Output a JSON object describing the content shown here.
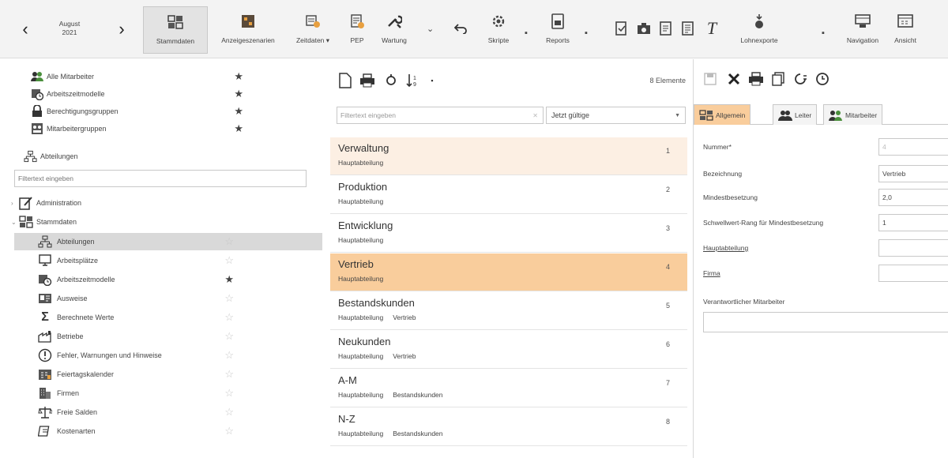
{
  "toolbar": {
    "date_month": "August",
    "date_year": "2021",
    "items": [
      {
        "label": "Stammdaten",
        "active": true
      },
      {
        "label": "Anzeigeszenarien"
      },
      {
        "label": "Zeitdaten ▾"
      },
      {
        "label": "PEP"
      },
      {
        "label": "Wartung"
      },
      {
        "label": "Skripte"
      },
      {
        "label": "Reports"
      },
      {
        "label": "Lohnexporte"
      },
      {
        "label": "Navigation"
      },
      {
        "label": "Ansicht"
      }
    ]
  },
  "left": {
    "favorites": [
      {
        "label": "Alle Mitarbeiter"
      },
      {
        "label": "Arbeitszeitmodelle"
      },
      {
        "label": "Berechtigungsgruppen"
      },
      {
        "label": "Mitarbeitergruppen"
      },
      {
        "label": "Abteilungen"
      }
    ],
    "filter_placeholder": "Filtertext eingeben",
    "tree": [
      {
        "label": "Administration"
      },
      {
        "label": "Stammdaten"
      }
    ],
    "children": [
      {
        "label": "Abteilungen",
        "starred": false
      },
      {
        "label": "Arbeitsplätze",
        "starred": false
      },
      {
        "label": "Arbeitszeitmodelle",
        "starred": true
      },
      {
        "label": "Ausweise",
        "starred": false
      },
      {
        "label": "Berechnete Werte",
        "starred": false
      },
      {
        "label": "Betriebe",
        "starred": false
      },
      {
        "label": "Fehler, Warnungen und Hinweise",
        "starred": false
      },
      {
        "label": "Feiertagskalender",
        "starred": false
      },
      {
        "label": "Firmen",
        "starred": false
      },
      {
        "label": "Freie Salden",
        "starred": false
      },
      {
        "label": "Kostenarten",
        "starred": false
      }
    ]
  },
  "middle": {
    "count": "8 Elemente",
    "filter_placeholder": "Filtertext eingeben",
    "select_value": "Jetzt gültige",
    "items": [
      {
        "name": "Verwaltung",
        "meta": [
          "Hauptabteilung"
        ],
        "num": "1"
      },
      {
        "name": "Produktion",
        "meta": [
          "Hauptabteilung"
        ],
        "num": "2"
      },
      {
        "name": "Entwicklung",
        "meta": [
          "Hauptabteilung"
        ],
        "num": "3"
      },
      {
        "name": "Vertrieb",
        "meta": [
          "Hauptabteilung"
        ],
        "num": "4"
      },
      {
        "name": "Bestandskunden",
        "meta": [
          "Hauptabteilung",
          "Vertrieb"
        ],
        "num": "5"
      },
      {
        "name": "Neukunden",
        "meta": [
          "Hauptabteilung",
          "Vertrieb"
        ],
        "num": "6"
      },
      {
        "name": "A-M",
        "meta": [
          "Hauptabteilung",
          "Bestandskunden"
        ],
        "num": "7"
      },
      {
        "name": "N-Z",
        "meta": [
          "Hauptabteilung",
          "Bestandskunden"
        ],
        "num": "8"
      }
    ]
  },
  "right": {
    "tabs": [
      {
        "label": "Allgemein"
      },
      {
        "label": "Leiter"
      },
      {
        "label": "Mitarbeiter"
      }
    ],
    "form": {
      "nummer_label": "Nummer*",
      "nummer_value": "4",
      "bezeichnung_label": "Bezeichnung",
      "bezeichnung_value": "Vertrieb",
      "mindest_label": "Mindestbesetzung",
      "mindest_value": "2,0",
      "schwell_label": "Schwellwert-Rang für Mindestbesetzung",
      "schwell_value": "1",
      "haupt_label": "Hauptabteilung",
      "firma_label": "Firma",
      "verant_label": "Verantwortlicher Mitarbeiter"
    }
  },
  "colors": {
    "selected_row": "#f9cd9c",
    "hover_row": "#fcefe3",
    "active_tab": "#f9cd9c"
  }
}
